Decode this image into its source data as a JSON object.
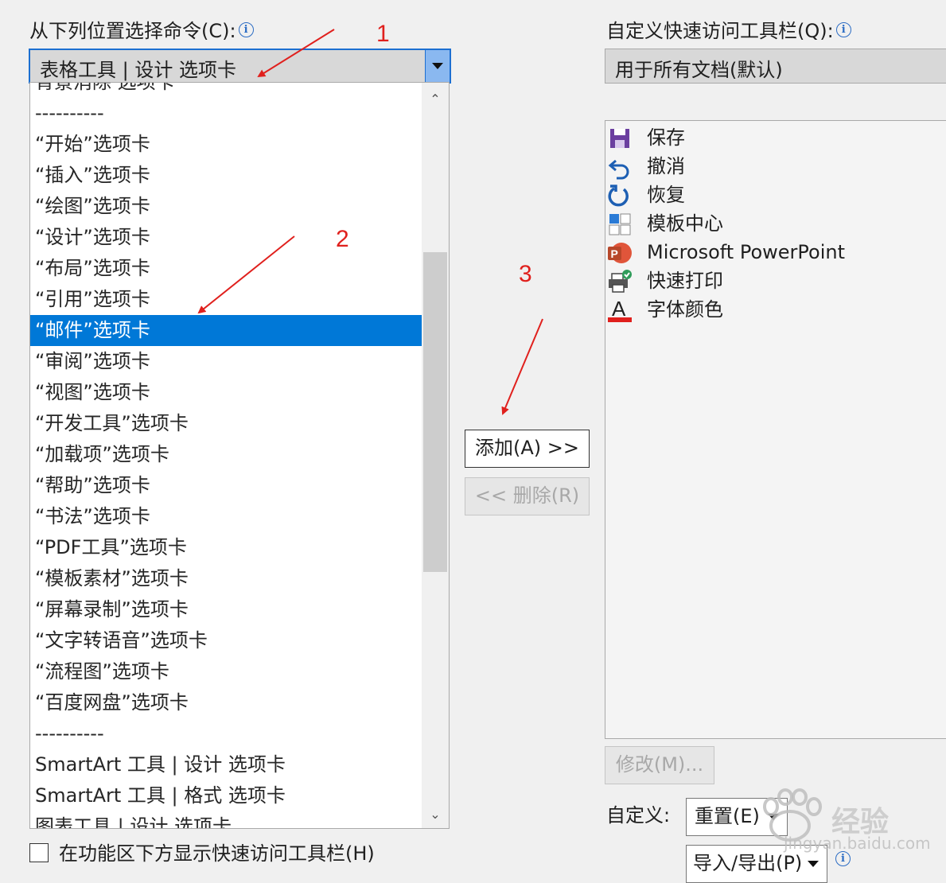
{
  "left_panel": {
    "title": "从下列位置选择命令(C):",
    "combo_value": "表格工具 | 设计 选项卡",
    "items": [
      "背景消除 选项卡",
      "----------",
      "“开始”选项卡",
      "“插入”选项卡",
      "“绘图”选项卡",
      "“设计”选项卡",
      "“布局”选项卡",
      "“引用”选项卡",
      "“邮件”选项卡",
      "“审阅”选项卡",
      "“视图”选项卡",
      "“开发工具”选项卡",
      "“加载项”选项卡",
      "“帮助”选项卡",
      "“书法”选项卡",
      "“PDF工具”选项卡",
      "“模板素材”选项卡",
      "“屏幕录制”选项卡",
      "“文字转语音”选项卡",
      "“流程图”选项卡",
      "“百度网盘”选项卡",
      "----------",
      "SmartArt 工具 | 设计 选项卡",
      "SmartArt 工具 | 格式 选项卡",
      "图表工具 | 设计 选项卡"
    ],
    "selected_item": "“邮件”选项卡",
    "checkbox_label": "在功能区下方显示快速访问工具栏(H)"
  },
  "buttons": {
    "add": "添加(A) >>",
    "remove": "<< 删除(R)",
    "modify": "修改(M)...",
    "reset": "重置(E)",
    "import_export": "导入/导出(P)"
  },
  "right_panel": {
    "title": "自定义快速访问工具栏(Q):",
    "combo_value": "用于所有文档(默认)",
    "items": [
      {
        "icon": "save-icon",
        "label": "保存"
      },
      {
        "icon": "undo-icon",
        "label": "撤消"
      },
      {
        "icon": "redo-icon",
        "label": "恢复"
      },
      {
        "icon": "template-center-icon",
        "label": "模板中心"
      },
      {
        "icon": "powerpoint-icon",
        "label": "Microsoft PowerPoint"
      },
      {
        "icon": "quick-print-icon",
        "label": "快速打印"
      },
      {
        "icon": "font-color-icon",
        "label": "字体颜色"
      }
    ],
    "customize_label": "自定义:"
  },
  "annotations": [
    "1",
    "2",
    "3"
  ],
  "watermark": {
    "text": "经验",
    "url": "jingyan.baidu.com"
  },
  "colors": {
    "selection": "#0078d7",
    "annotation": "#e0201d",
    "combo_border": "#1c6fd1"
  }
}
